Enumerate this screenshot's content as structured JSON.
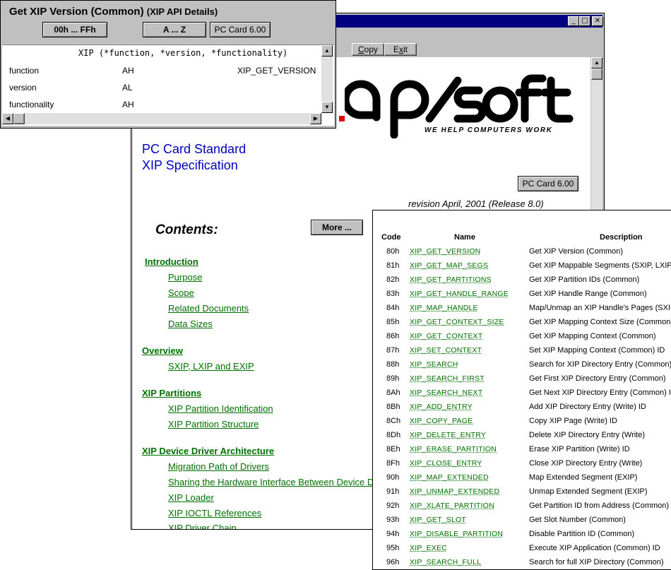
{
  "main_window": {
    "menu": {
      "copy": "Copy",
      "exit": "Exit"
    },
    "logo_tagline": "WE HELP COMPUTERS WORK",
    "title_line1": "PC Card Standard",
    "title_line2": "XIP Specification",
    "pccard_button": "PC Card 6.00",
    "revision": "revision April, 2001 (Release 8.0)",
    "contents_heading": "Contents:",
    "more_button": "More ...",
    "toc": [
      {
        "section": "Introduction",
        "items": [
          "Purpose",
          "Scope",
          "Related Documents",
          "Data Sizes"
        ]
      },
      {
        "section": "Overview",
        "items": [
          "SXIP, LXIP and EXIP"
        ]
      },
      {
        "section": "XIP Partitions",
        "items": [
          "XIP Partition Identification",
          "XIP Partition Structure"
        ]
      },
      {
        "section": "XIP Device Driver Architecture",
        "items": [
          "Migration Path of Drivers",
          "Sharing the Hardware Interface Between Device Dr",
          "XIP Loader",
          "XIP IOCTL References",
          "XIP Driver Chain"
        ]
      }
    ]
  },
  "details_window": {
    "title": "Get XIP Version (Common)",
    "subtitle": "(XIP API Details)",
    "buttons": [
      "00h ... FFh",
      "A ... Z",
      "PC Card 6.00"
    ],
    "signature": "XIP (*function, *version, *functionality)",
    "rows": [
      {
        "param": "function",
        "reg": "AH",
        "value": "XIP_GET_VERSION"
      },
      {
        "param": "version",
        "reg": "AL",
        "value": ""
      },
      {
        "param": "functionality",
        "reg": "AH",
        "value": ""
      }
    ]
  },
  "function_table": {
    "headers": {
      "code": "Code",
      "name": "Name",
      "description": "Description"
    },
    "rows": [
      {
        "code": "80h",
        "name": "XIP_GET_VERSION",
        "desc": "Get XIP Version (Common)"
      },
      {
        "code": "81h",
        "name": "XIP_GET_MAP_SEGS",
        "desc": "Get XIP Mappable Segments (SXIP, LXIP)"
      },
      {
        "code": "82h",
        "name": "XIP_GET_PARTITIONS",
        "desc": "Get XIP Partition IDs (Common)"
      },
      {
        "code": "83h",
        "name": "XIP_GET_HANDLE_RANGE",
        "desc": "Get XIP Handle Range (Common)"
      },
      {
        "code": "84h",
        "name": "XIP_MAP_HANDLE",
        "desc": "Map/Unmap an XIP Handle's Pages (SXIP,"
      },
      {
        "code": "85h",
        "name": "XIP_GET_CONTEXT_SIZE",
        "desc": "Get XIP Mapping Context Size (Common)"
      },
      {
        "code": "86h",
        "name": "XIP_GET_CONTEXT",
        "desc": "Get XIP Mapping Context (Common)"
      },
      {
        "code": "87h",
        "name": "XIP_SET_CONTEXT",
        "desc": "Set XIP Mapping Context (Common) ID"
      },
      {
        "code": "88h",
        "name": "XIP_SEARCH",
        "desc": "Search for XIP Directory Entry (Common)"
      },
      {
        "code": "89h",
        "name": "XIP_SEARCH_FIRST",
        "desc": "Get First XIP Directory Entry (Common)"
      },
      {
        "code": "8Ah",
        "name": "XIP_SEARCH_NEXT",
        "desc": "Get Next XIP Directory Entry (Common) ID"
      },
      {
        "code": "8Bh",
        "name": "XIP_ADD_ENTRY",
        "desc": "Add XIP Directory Entry (Write) ID"
      },
      {
        "code": "8Ch",
        "name": "XIP_COPY_PAGE",
        "desc": "Copy XIP Page (Write) ID"
      },
      {
        "code": "8Dh",
        "name": "XIP_DELETE_ENTRY",
        "desc": "Delete XIP Directory Entry (Write)"
      },
      {
        "code": "8Eh",
        "name": "XIP_ERASE_PARTITION",
        "desc": "Erase XIP Partition (Write) ID"
      },
      {
        "code": "8Fh",
        "name": "XIP_CLOSE_ENTRY",
        "desc": "Close XIP Directory Entry (Write)"
      },
      {
        "code": "90h",
        "name": "XIP_MAP_EXTENDED",
        "desc": "Map Extended Segment (EXIP)"
      },
      {
        "code": "91h",
        "name": "XIP_UNMAP_EXTENDED",
        "desc": "Unmap Extended Segment (EXIP)"
      },
      {
        "code": "92h",
        "name": "XIP_XLATE_PARTITION",
        "desc": "Get Partition ID from Address (Common)"
      },
      {
        "code": "93h",
        "name": "XIP_GET_SLOT",
        "desc": "Get Slot Number (Common)"
      },
      {
        "code": "94h",
        "name": "XIP_DISABLE_PARTITION",
        "desc": "Disable Partition ID (Common)"
      },
      {
        "code": "95h",
        "name": "XIP_EXEC",
        "desc": "Execute XIP Application (Common) ID"
      },
      {
        "code": "96h",
        "name": "XIP_SEARCH_FULL",
        "desc": "Search for full XIP Directory (Common)"
      }
    ]
  },
  "icons": {
    "minimize": "_",
    "maximize": "□",
    "close": "✕",
    "arrow_up": "▲",
    "arrow_down": "▼",
    "arrow_left": "◀",
    "arrow_right": "▶"
  },
  "colors": {
    "title_bar": "#000080",
    "link_green": "#007000",
    "heading_blue": "#0000c0",
    "logo_red": "#e00000"
  }
}
